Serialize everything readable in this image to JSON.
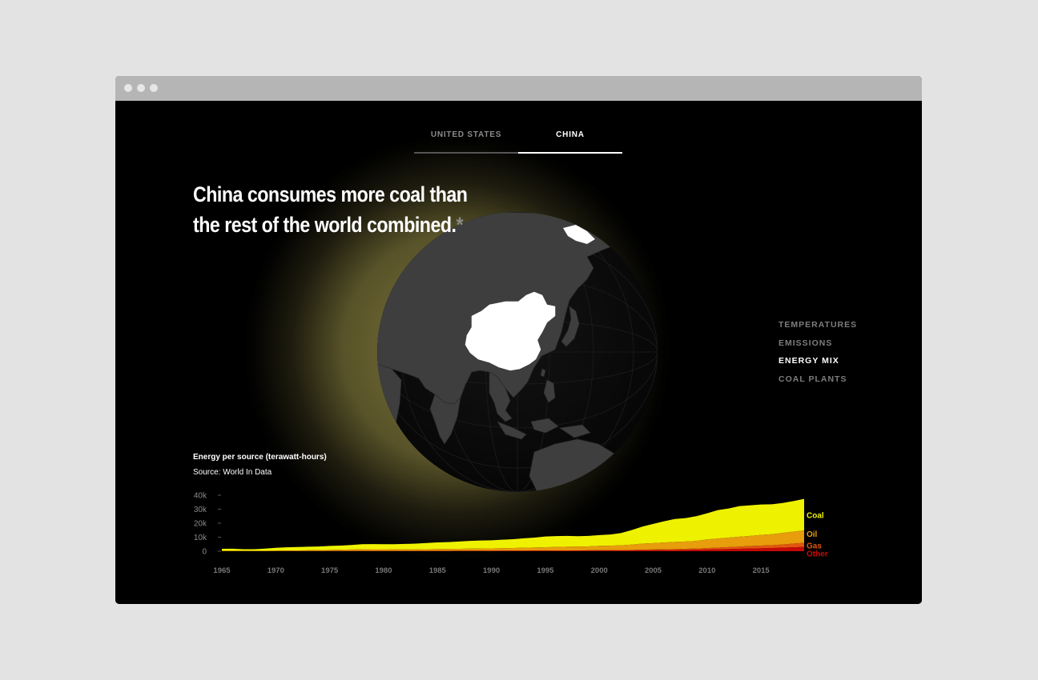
{
  "tabs": [
    {
      "label": "UNITED STATES",
      "active": false
    },
    {
      "label": "CHINA",
      "active": true
    }
  ],
  "headline": {
    "line1": "China consumes more coal than",
    "line2": "the rest of the world combined.",
    "asterisk": "*"
  },
  "sidenav": {
    "items": [
      {
        "label": "TEMPERATURES",
        "active": false
      },
      {
        "label": "EMISSIONS",
        "active": false
      },
      {
        "label": "ENERGY MIX",
        "active": true
      },
      {
        "label": "COAL PLANTS",
        "active": false
      }
    ]
  },
  "colors": {
    "coal": "#eef200",
    "oil": "#e79d0c",
    "gas": "#e2570e",
    "other": "#c50a07",
    "glow": "#8a8240",
    "land": "#3e3e3e",
    "highlight_land": "#ffffff",
    "ocean": "#080808"
  },
  "chart_data": {
    "type": "area",
    "stacked": true,
    "title": "Energy per source (terawatt-hours)",
    "source": "Source: World In Data",
    "x": [
      1965,
      1966,
      1967,
      1968,
      1969,
      1970,
      1971,
      1972,
      1973,
      1974,
      1975,
      1976,
      1977,
      1978,
      1979,
      1980,
      1981,
      1982,
      1983,
      1984,
      1985,
      1986,
      1987,
      1988,
      1989,
      1990,
      1991,
      1992,
      1993,
      1994,
      1995,
      1996,
      1997,
      1998,
      1999,
      2000,
      2001,
      2002,
      2003,
      2004,
      2005,
      2006,
      2007,
      2008,
      2009,
      2010,
      2011,
      2012,
      2013,
      2014,
      2015,
      2016,
      2017,
      2018,
      2019
    ],
    "series": [
      {
        "name": "Other",
        "values": [
          50,
          55,
          55,
          55,
          60,
          70,
          75,
          80,
          90,
          95,
          110,
          115,
          125,
          135,
          140,
          145,
          150,
          160,
          170,
          185,
          200,
          210,
          220,
          240,
          250,
          260,
          280,
          290,
          310,
          330,
          350,
          370,
          380,
          400,
          420,
          450,
          480,
          520,
          560,
          620,
          700,
          780,
          860,
          950,
          1050,
          1200,
          1350,
          1500,
          1700,
          1900,
          2100,
          2300,
          2500,
          2800,
          3100
        ]
      },
      {
        "name": "Gas",
        "values": [
          10,
          12,
          14,
          15,
          18,
          20,
          25,
          30,
          35,
          40,
          50,
          60,
          70,
          80,
          85,
          90,
          90,
          90,
          90,
          100,
          100,
          110,
          110,
          120,
          120,
          130,
          130,
          130,
          140,
          150,
          160,
          170,
          190,
          200,
          220,
          260,
          300,
          330,
          370,
          420,
          480,
          560,
          670,
          780,
          880,
          1050,
          1250,
          1440,
          1600,
          1780,
          1880,
          1990,
          2290,
          2640,
          2870
        ]
      },
      {
        "name": "Oil",
        "values": [
          130,
          150,
          150,
          180,
          220,
          300,
          400,
          480,
          560,
          650,
          780,
          880,
          1000,
          1130,
          1180,
          1170,
          1120,
          1100,
          1120,
          1160,
          1240,
          1320,
          1400,
          1500,
          1580,
          1620,
          1740,
          1870,
          2040,
          2150,
          2350,
          2480,
          2680,
          2720,
          2800,
          3130,
          3170,
          3400,
          3770,
          4390,
          4610,
          4890,
          5130,
          5230,
          5400,
          6190,
          6440,
          6780,
          7050,
          7280,
          7670,
          7880,
          8280,
          8590,
          8860
        ]
      },
      {
        "name": "Coal",
        "values": [
          1510,
          1580,
          1220,
          1180,
          1550,
          2050,
          2280,
          2440,
          2530,
          2570,
          2850,
          2920,
          3230,
          3650,
          3680,
          3630,
          3610,
          3860,
          4060,
          4400,
          4740,
          4890,
          5200,
          5530,
          5710,
          5760,
          6030,
          6310,
          6740,
          7110,
          7620,
          7800,
          7700,
          7430,
          7520,
          7630,
          7980,
          8690,
          10350,
          12120,
          13680,
          15150,
          16320,
          16690,
          17670,
          18620,
          20320,
          20780,
          21870,
          21860,
          21680,
          21320,
          21390,
          21740,
          22520
        ]
      }
    ],
    "ylim": [
      0,
      40000
    ],
    "yticks": [
      "40k",
      "30k",
      "20k",
      "10k",
      "0"
    ],
    "xticks": [
      "1965",
      "1970",
      "1975",
      "1980",
      "1985",
      "1990",
      "1995",
      "2000",
      "2005",
      "2010",
      "2015"
    ],
    "legend_placement": "right-end",
    "grid": false
  }
}
